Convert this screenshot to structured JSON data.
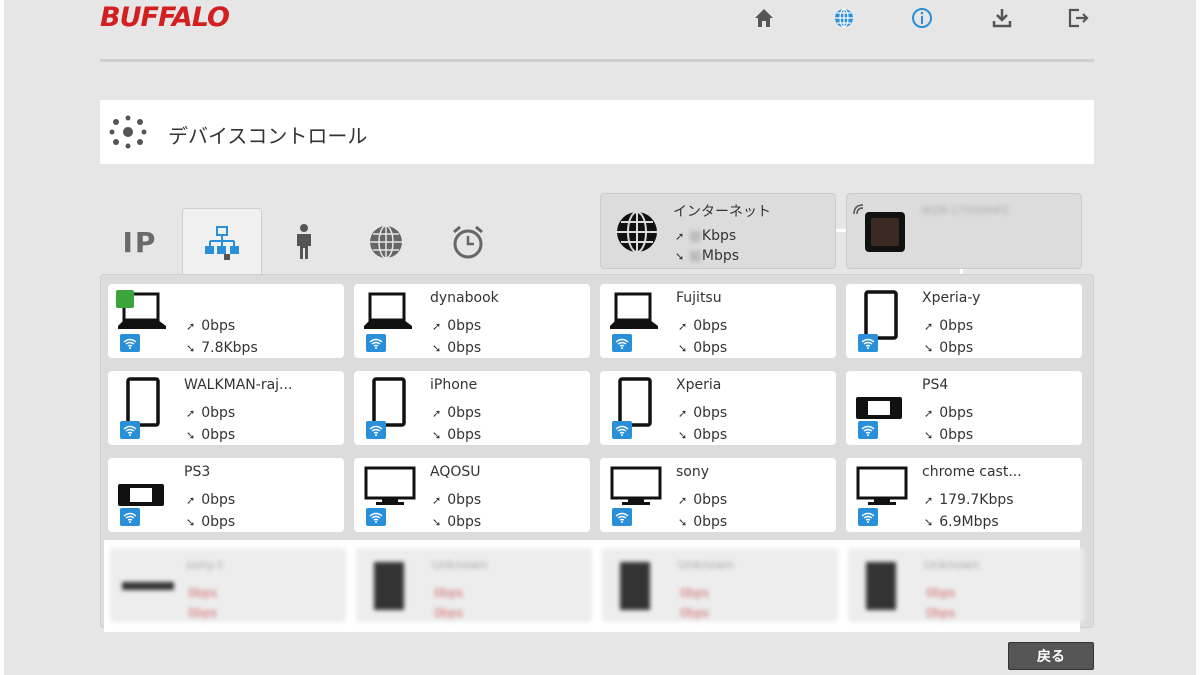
{
  "brand": "BUFFALO",
  "header_icons": [
    "home-icon",
    "globe-icon",
    "info-icon",
    "download-icon",
    "logout-icon"
  ],
  "page_title": "デバイスコントロール",
  "tabs": [
    {
      "name": "ip",
      "label": "IP",
      "active": false
    },
    {
      "name": "network-map",
      "label": "",
      "active": true
    },
    {
      "name": "person",
      "label": "",
      "active": false
    },
    {
      "name": "globe",
      "label": "",
      "active": false
    },
    {
      "name": "alarm",
      "label": "",
      "active": false
    }
  ],
  "internet": {
    "title": "インターネット",
    "up": "Kbps",
    "down": "Mbps"
  },
  "router": {
    "name": "WZR-1750DHP2"
  },
  "devices": [
    {
      "name": "",
      "up": "0bps",
      "down": "7.8Kbps",
      "type": "laptop",
      "status": "online"
    },
    {
      "name": "dynabook",
      "up": "0bps",
      "down": "0bps",
      "type": "laptop"
    },
    {
      "name": "Fujitsu",
      "up": "0bps",
      "down": "0bps",
      "type": "laptop"
    },
    {
      "name": "Xperia-y",
      "up": "0bps",
      "down": "0bps",
      "type": "tablet"
    },
    {
      "name": "WALKMAN-raj...",
      "up": "0bps",
      "down": "0bps",
      "type": "tablet"
    },
    {
      "name": "iPhone",
      "up": "0bps",
      "down": "0bps",
      "type": "tablet"
    },
    {
      "name": "Xperia",
      "up": "0bps",
      "down": "0bps",
      "type": "tablet"
    },
    {
      "name": "PS4",
      "up": "0bps",
      "down": "0bps",
      "type": "game"
    },
    {
      "name": "PS3",
      "up": "0bps",
      "down": "0bps",
      "type": "game"
    },
    {
      "name": "AQOSU",
      "up": "0bps",
      "down": "0bps",
      "type": "tv"
    },
    {
      "name": "sony",
      "up": "0bps",
      "down": "0bps",
      "type": "tv"
    },
    {
      "name": "chrome cast...",
      "up": "179.7Kbps",
      "down": "6.9Mbps",
      "type": "tv"
    }
  ],
  "blurred_devices": [
    {
      "name": "sony-t",
      "up": "0bps",
      "down": "0bps"
    },
    {
      "name": "Unknown",
      "up": "0bps",
      "down": "0bps"
    },
    {
      "name": "Unknown",
      "up": "0bps",
      "down": "0bps"
    },
    {
      "name": "Unknown",
      "up": "0bps",
      "down": "0bps"
    }
  ],
  "back_button": "戻る",
  "colors": {
    "brand": "#d31f1f",
    "wifi": "#2a8fd9",
    "accent": "#2a8fd9"
  }
}
